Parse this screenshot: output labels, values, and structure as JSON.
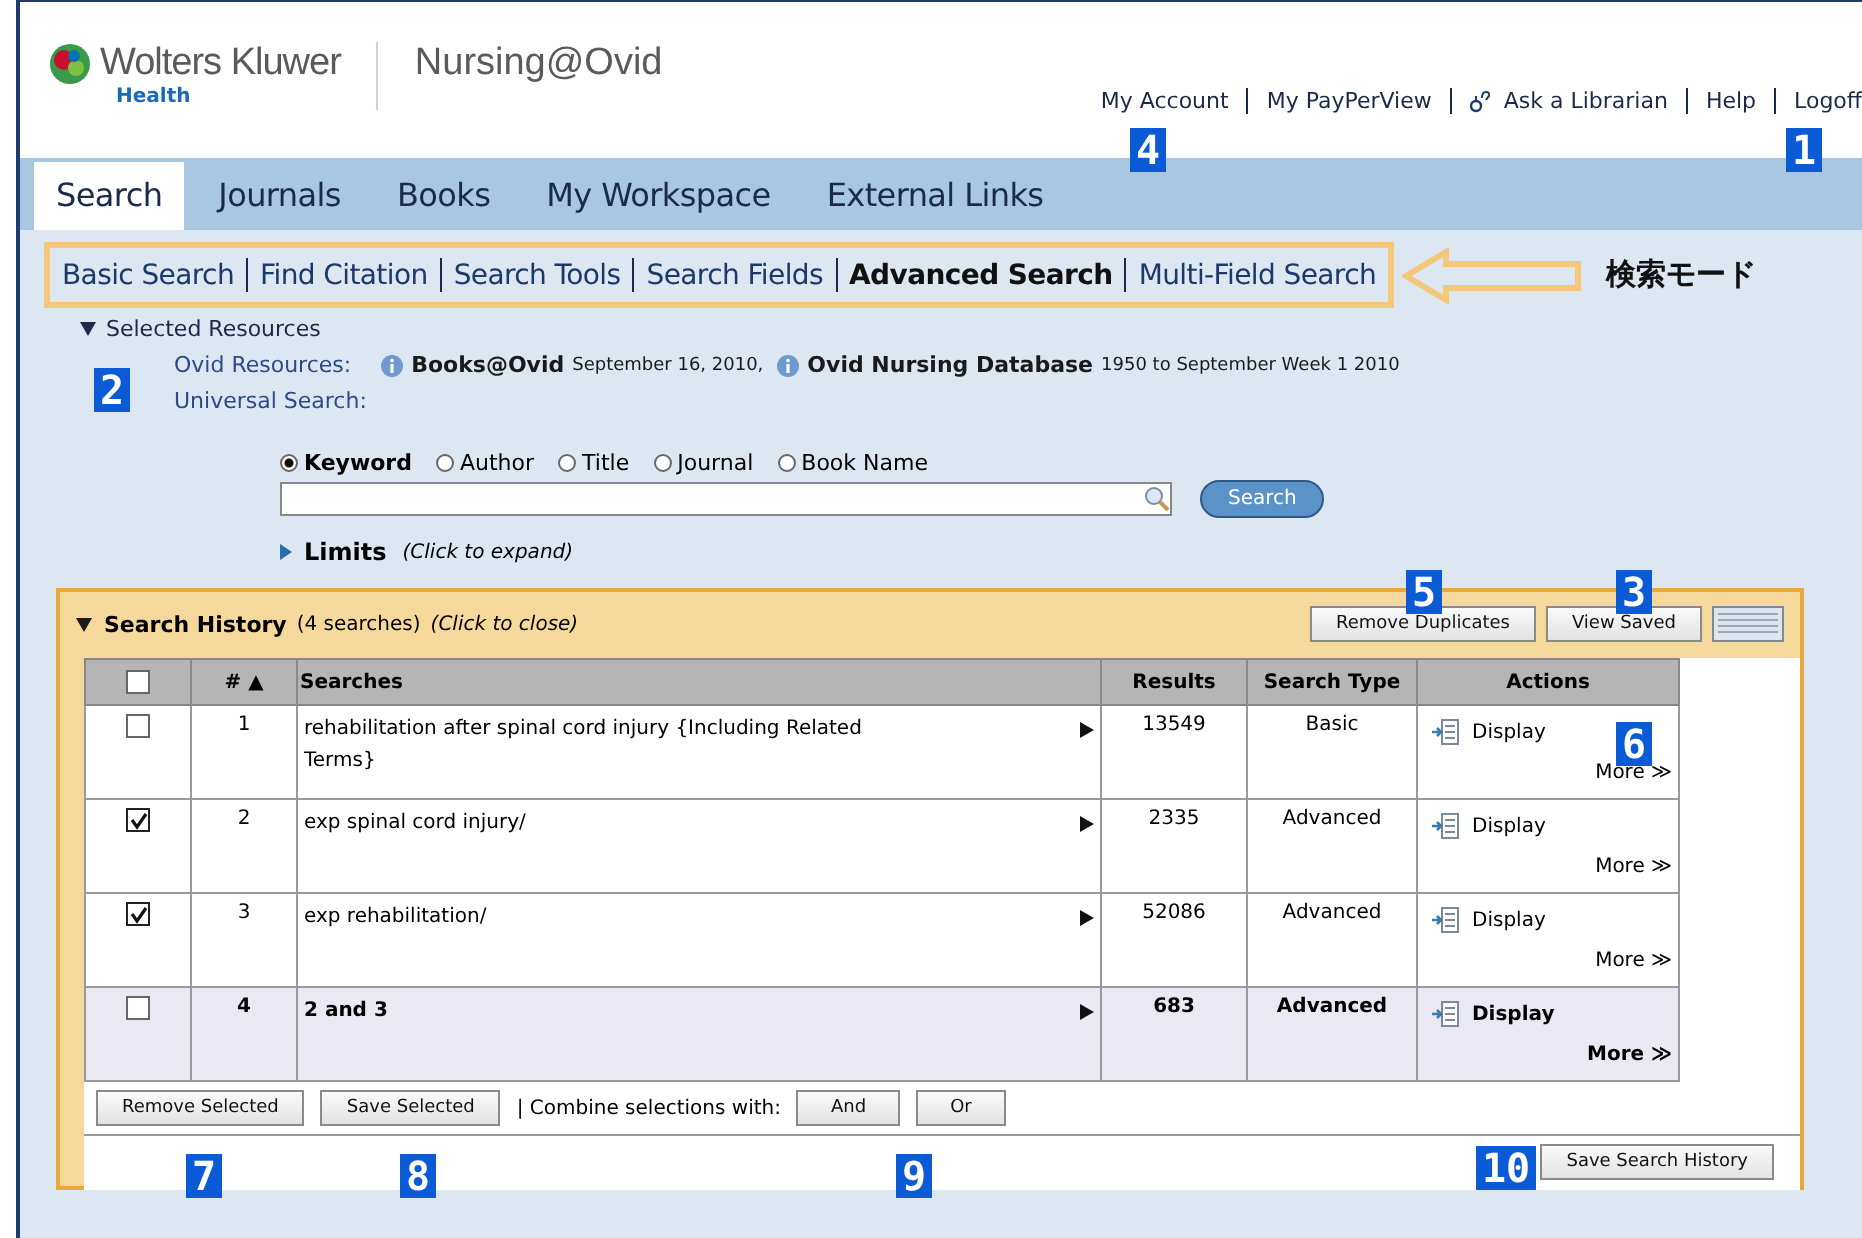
{
  "header": {
    "brand": "Wolters Kluwer",
    "brand_sub": "Health",
    "product": "Nursing@Ovid"
  },
  "top_links": [
    {
      "label": "My Account",
      "kind": "plain"
    },
    {
      "label": "My PayPerView",
      "kind": "plain"
    },
    {
      "label": "Ask a Librarian",
      "kind": "librarian"
    },
    {
      "label": "Help",
      "kind": "plain"
    },
    {
      "label": "Logoff",
      "kind": "plain"
    }
  ],
  "tabs": [
    {
      "label": "Search",
      "selected": true
    },
    {
      "label": "Journals",
      "selected": false
    },
    {
      "label": "Books",
      "selected": false
    },
    {
      "label": "My Workspace",
      "selected": false
    },
    {
      "label": "External Links",
      "selected": false
    }
  ],
  "search_modes": [
    {
      "label": "Basic Search",
      "selected": false
    },
    {
      "label": "Find Citation",
      "selected": false
    },
    {
      "label": "Search Tools",
      "selected": false
    },
    {
      "label": "Search Fields",
      "selected": false
    },
    {
      "label": "Advanced Search",
      "selected": true
    },
    {
      "label": "Multi-Field Search",
      "selected": false
    }
  ],
  "mode_annotation": "検索モード",
  "selected_resources": {
    "title": "Selected Resources",
    "expanded": true,
    "ovid_label": "Ovid Resources:",
    "resources": [
      {
        "name": "Books@Ovid",
        "coverage": "September 16, 2010",
        "sep": ","
      },
      {
        "name": "Ovid Nursing Database",
        "coverage": "1950 to September Week 1 2010"
      }
    ],
    "universal_label": "Universal Search:"
  },
  "search_options": [
    {
      "label": "Keyword",
      "selected": true
    },
    {
      "label": "Author",
      "selected": false
    },
    {
      "label": "Title",
      "selected": false
    },
    {
      "label": "Journal",
      "selected": false
    },
    {
      "label": "Book Name",
      "selected": false
    }
  ],
  "search_button": "Search",
  "limits": {
    "label": "Limits",
    "hint": "(Click to expand)",
    "expanded": false
  },
  "history": {
    "title": "Search History",
    "count": "(4 searches)",
    "hint": "(Click to close)",
    "expanded": true,
    "buttons": [
      "Remove Duplicates",
      "View Saved"
    ],
    "columns": [
      "#",
      "Searches",
      "Results",
      "Search Type",
      "Actions"
    ],
    "sort_mark": "▲",
    "all_checked": false,
    "rows": [
      {
        "checked": false,
        "highlighted": false,
        "num": "1",
        "search": "rehabilitation after spinal cord injury {Including Related Terms}",
        "results": "13549",
        "type": "Basic",
        "display": "Display",
        "more": "More ≫"
      },
      {
        "checked": true,
        "highlighted": false,
        "num": "2",
        "search": "exp spinal cord injury/",
        "results": "2335",
        "type": "Advanced",
        "display": "Display",
        "more": "More ≫"
      },
      {
        "checked": true,
        "highlighted": false,
        "num": "3",
        "search": "exp rehabilitation/",
        "results": "52086",
        "type": "Advanced",
        "display": "Display",
        "more": "More ≫"
      },
      {
        "checked": false,
        "highlighted": true,
        "num": "4",
        "search": "2 and 3",
        "results": "683",
        "type": "Advanced",
        "display": "Display",
        "more": "More ≫"
      }
    ],
    "remove_selected": "Remove Selected",
    "save_selected": "Save Selected",
    "combine_label": "| Combine selections with:",
    "combine_buttons": [
      "And",
      "Or"
    ],
    "save_history": "Save Search History"
  },
  "callouts": [
    "1",
    "2",
    "3",
    "4",
    "5",
    "6",
    "7",
    "8",
    "9",
    "10"
  ]
}
